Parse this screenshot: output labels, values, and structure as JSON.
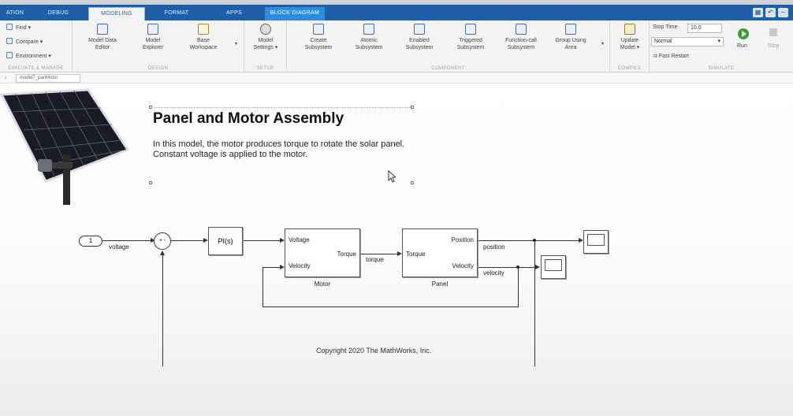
{
  "tabs": [
    {
      "label": "ATION"
    },
    {
      "label": "DEBUG"
    },
    {
      "label": "MODELING"
    },
    {
      "label": "FORMAT"
    },
    {
      "label": "APPS"
    },
    {
      "label": "BLOCK DIAGRAM"
    }
  ],
  "ribbon": {
    "evaluate_manage": {
      "label": "EVALUATE & MANAGE",
      "find": "Find",
      "compare": "Compare",
      "environment": "Environment"
    },
    "design": {
      "label": "DESIGN",
      "model_data_editor": [
        "Model Data",
        "Editor"
      ],
      "model_explorer": [
        "Model",
        "Explorer"
      ],
      "base_workspace": [
        "Base",
        "Workspace"
      ]
    },
    "setup": {
      "label": "SETUP",
      "model_settings": [
        "Model",
        "Settings ▾"
      ]
    },
    "component": {
      "label": "COMPONENT",
      "create_subsystem": [
        "Create",
        "Subsystem"
      ],
      "atomic_subsystem": [
        "Atomic",
        "Subsystem"
      ],
      "enabled_subsystem": [
        "Enabled",
        "Subsystem"
      ],
      "triggered_subsystem": [
        "Triggered",
        "Subsystem"
      ],
      "function_call_subsystem": [
        "Function-call",
        "Subsystem"
      ],
      "group_using_area": [
        "Group Using",
        "Area"
      ]
    },
    "compile": {
      "label": "COMPILE",
      "update_model": [
        "Update",
        "Model ▾"
      ]
    },
    "simulate": {
      "label": "SIMULATE",
      "stop_time_label": "Stop Time",
      "stop_time_value": "10.0",
      "mode_value": "Normal",
      "fast_restart": "Fast Restart",
      "run": "Run",
      "stop": "Stop"
    }
  },
  "address": {
    "tab_label": "model7_panMotor"
  },
  "diagram": {
    "title": "Panel and Motor Assembly",
    "description": "In this model, the motor produces torque to rotate the solar panel. Constant voltage is applied to the motor.",
    "inport_number": "1",
    "inport_signal": "voltage",
    "pi_block": "PI(s)",
    "motor": {
      "name": "Motor",
      "in_voltage": "Voltage",
      "in_velocity": "Velocity",
      "out_torque": "Torque"
    },
    "panel": {
      "name": "Panel",
      "in_torque": "Torque",
      "out_position": "Position",
      "out_velocity": "Velocity"
    },
    "signals": {
      "torque": "torque",
      "position": "position",
      "velocity": "velocity"
    },
    "copyright": "Copyright 2020 The MathWorks, Inc."
  },
  "colors": {
    "tabbar": "#1f5fa8",
    "active_tab_text": "#3a5f8f",
    "run_green": "#3d9a35",
    "ribbon_bg": "#f3f3f3"
  }
}
